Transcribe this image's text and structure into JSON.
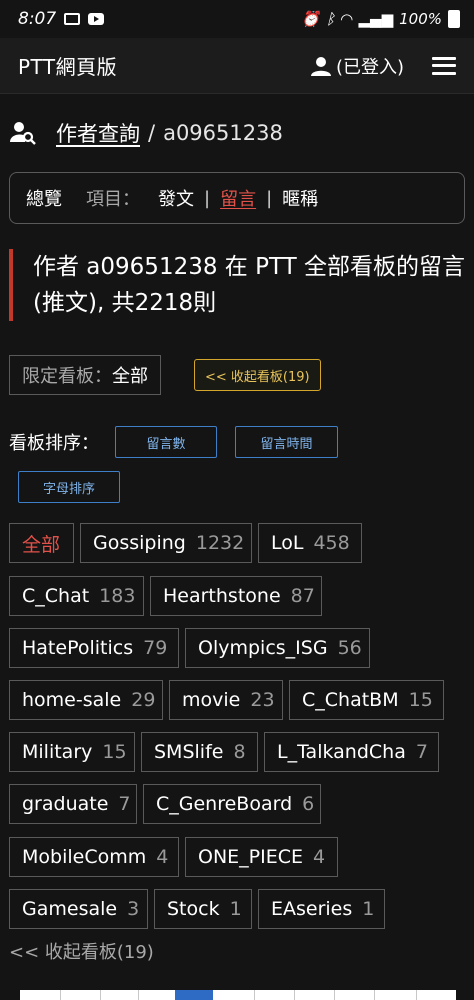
{
  "status_bar": {
    "time": "8:07",
    "battery": "100%"
  },
  "navbar": {
    "brand": "PTT網頁版",
    "login": "(已登入)"
  },
  "breadcrumb": {
    "link": "作者查詢",
    "separator": "/",
    "user": "a09651238"
  },
  "tabs": {
    "overview": "總覽",
    "label": "項目：",
    "items": [
      "發文",
      "留言",
      "暱稱"
    ],
    "separator": "|",
    "active_index": 1
  },
  "headline": "作者 a09651238 在 PTT 全部看板的留言(推文), 共2218則",
  "filter": {
    "key": "限定看板：",
    "value": "全部",
    "collapse_button": "<< 收起看板(19)"
  },
  "sort": {
    "label": "看板排序：",
    "buttons": [
      "留言數",
      "留言時間",
      "字母排序"
    ]
  },
  "boards": [
    {
      "name": "全部",
      "count": ""
    },
    {
      "name": "Gossiping",
      "count": "1232"
    },
    {
      "name": "LoL",
      "count": "458"
    },
    {
      "name": "C_Chat",
      "count": "183"
    },
    {
      "name": "Hearthstone",
      "count": "87"
    },
    {
      "name": "HatePolitics",
      "count": "79"
    },
    {
      "name": "Olympics_ISG",
      "count": "56"
    },
    {
      "name": "home-sale",
      "count": "29"
    },
    {
      "name": "movie",
      "count": "23"
    },
    {
      "name": "C_ChatBM",
      "count": "15"
    },
    {
      "name": "Military",
      "count": "15"
    },
    {
      "name": "SMSlife",
      "count": "8"
    },
    {
      "name": "L_TalkandCha",
      "count": "7"
    },
    {
      "name": "graduate",
      "count": "7"
    },
    {
      "name": "C_GenreBoard",
      "count": "6"
    },
    {
      "name": "MobileComm",
      "count": "4"
    },
    {
      "name": "ONE_PIECE",
      "count": "4"
    },
    {
      "name": "Gamesale",
      "count": "3"
    },
    {
      "name": "Stock",
      "count": "1"
    },
    {
      "name": "EAseries",
      "count": "1"
    }
  ],
  "bottom_collapse": "<< 收起看板(19)",
  "colors": {
    "accent_red": "#e0524a",
    "button_blue": "#3f7fc7",
    "button_gold": "#d4a72c",
    "background": "#141414"
  }
}
